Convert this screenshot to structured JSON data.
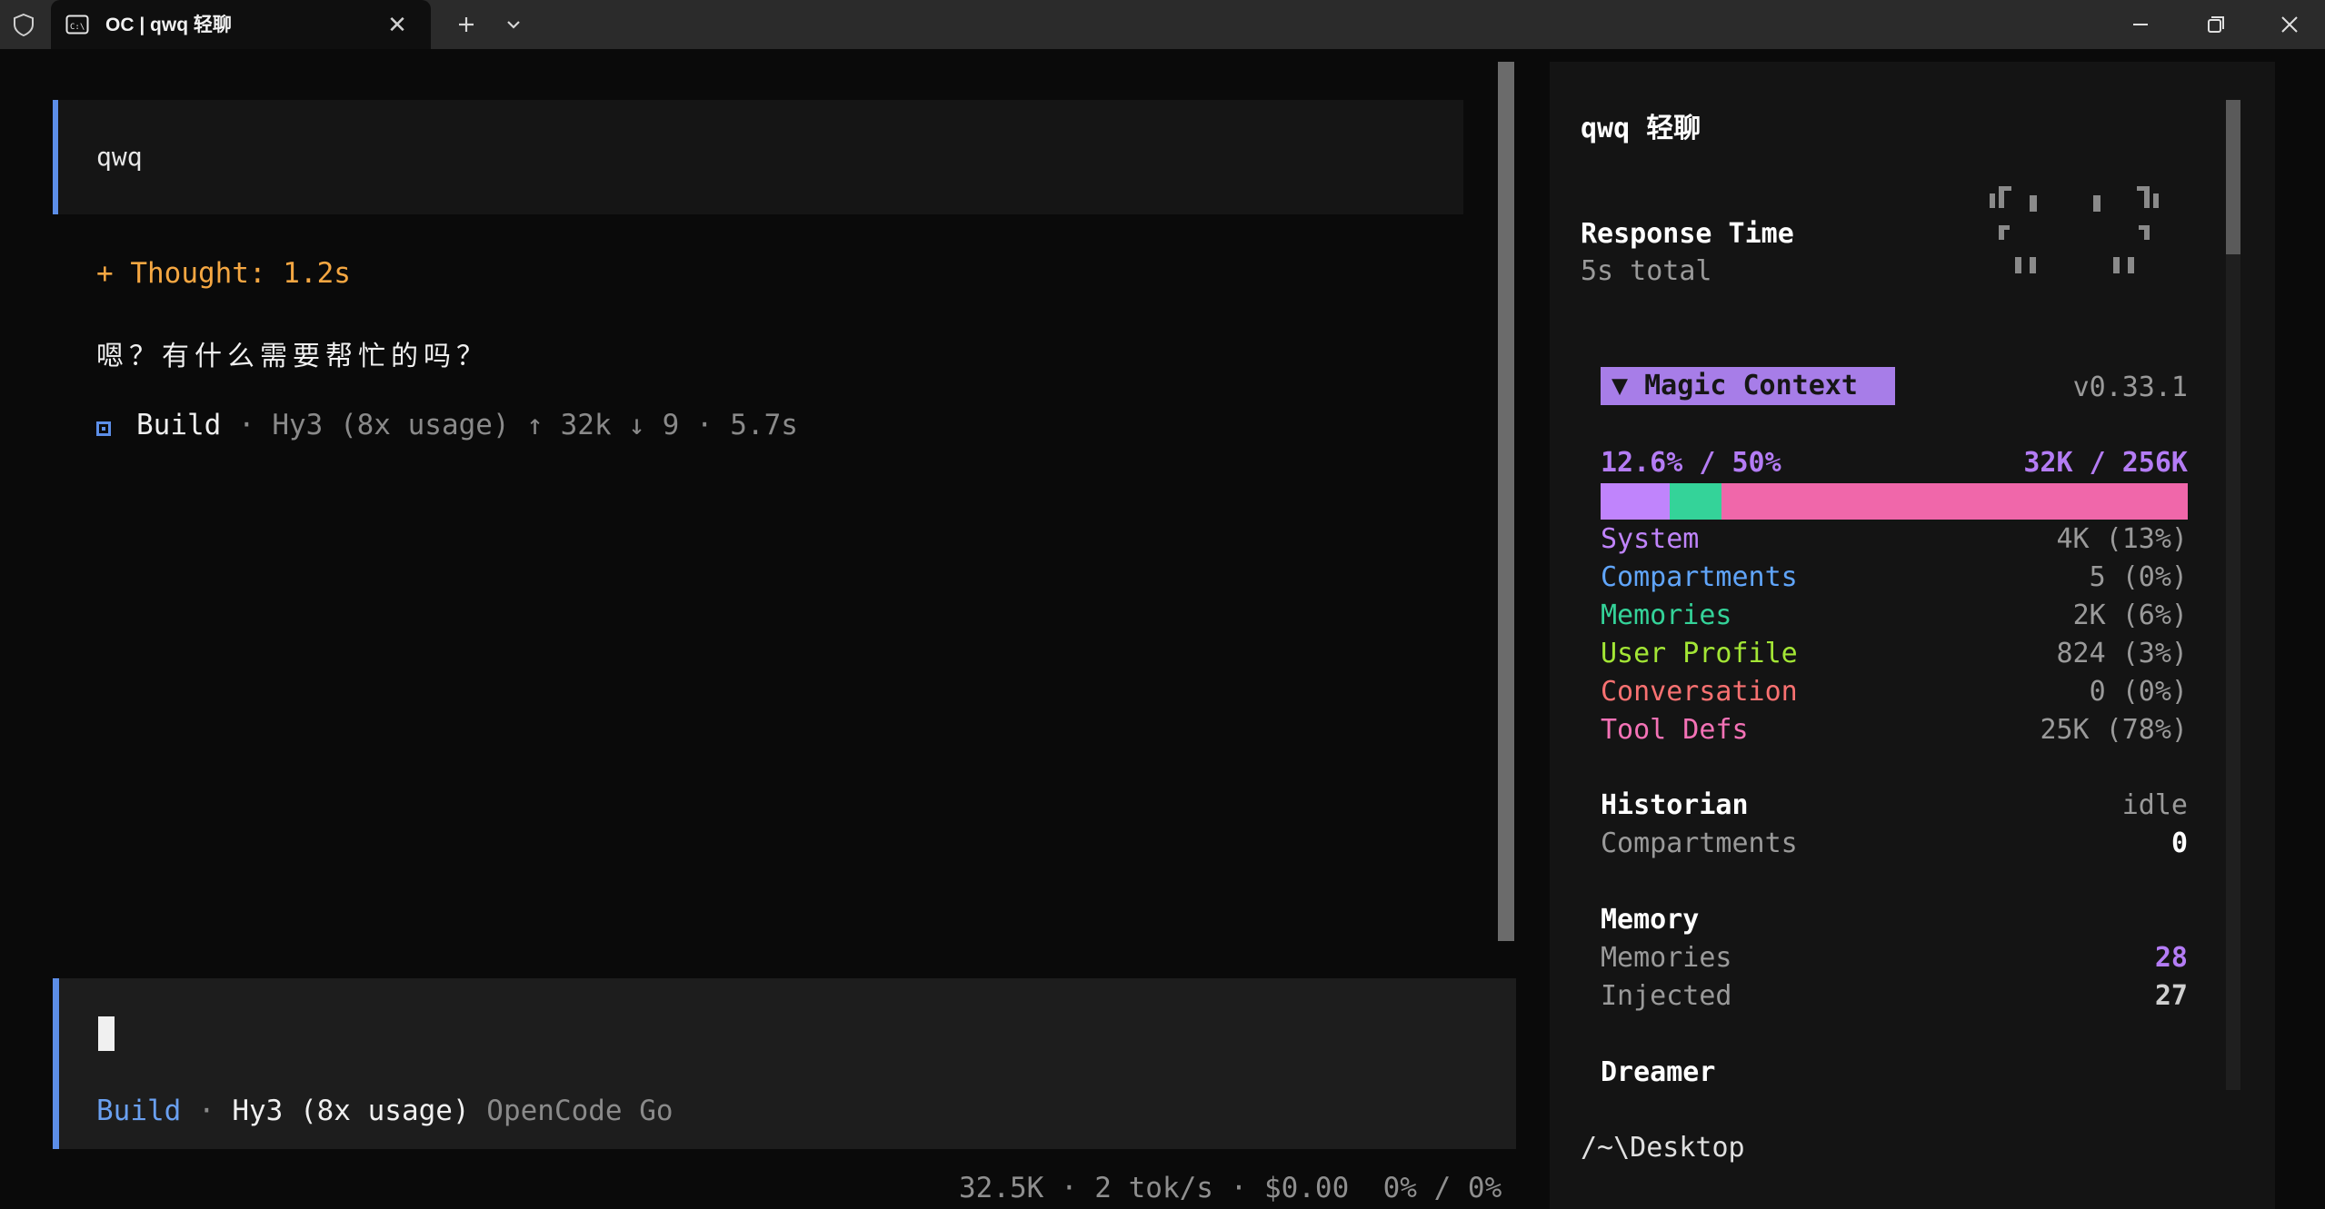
{
  "tab": {
    "title": "OC | qwq 轻聊",
    "icon": "terminal-icon"
  },
  "chat": {
    "user_message": "qwq",
    "thought": "+ Thought: 1.2s",
    "reply": "嗯？有什么需要帮忙的吗？",
    "build": {
      "mode": "Build",
      "sep1": " · ",
      "model": "Hy3 (8x usage)",
      "tokens_up": " ↑ 32k",
      "tokens_down": " ↓ 9",
      "sep2": " · ",
      "duration": "5.7s"
    }
  },
  "input": {
    "mode": "Build",
    "sep": " · ",
    "model": "Hy3 (8x usage)",
    "provider": " OpenCode Go"
  },
  "footer": {
    "status": "32.5K · 2 tok/s · $0.00  0% / 0%"
  },
  "sidebar": {
    "session_title": "qwq 轻聊",
    "response_time_label": "Response Time",
    "response_time_value": "5s total",
    "magic_context_label": "▼ Magic Context",
    "version": "v0.33.1",
    "usage_percent": "12.6% / 50%",
    "usage_tokens": "32K / 256K",
    "breakdown": [
      {
        "name": "System",
        "value": "4K (13%)",
        "color": "#c084fc"
      },
      {
        "name": "Compartments",
        "value": "5 (0%)",
        "color": "#60a5fa"
      },
      {
        "name": "Memories",
        "value": "2K (6%)",
        "color": "#34d399"
      },
      {
        "name": "User Profile",
        "value": "824 (3%)",
        "color": "#a3e635"
      },
      {
        "name": "Conversation",
        "value": "0 (0%)",
        "color": "#f87171"
      },
      {
        "name": "Tool Defs",
        "value": "25K (78%)",
        "color": "#f472b6"
      }
    ],
    "historian": {
      "title": "Historian",
      "status": "idle",
      "label": "Compartments",
      "value": "0"
    },
    "memory": {
      "title": "Memory",
      "memories_label": "Memories",
      "memories_value": "28",
      "injected_label": "Injected",
      "injected_value": "27"
    },
    "dreamer_title": "Dreamer",
    "cwd": "/~\\Desktop"
  },
  "context_bar": {
    "system_fraction": 0.118,
    "memories_fraction": 0.088
  },
  "colors": {
    "accent": "#5c8ee8",
    "magic": "#a77de8",
    "thought": "#f5a742"
  }
}
